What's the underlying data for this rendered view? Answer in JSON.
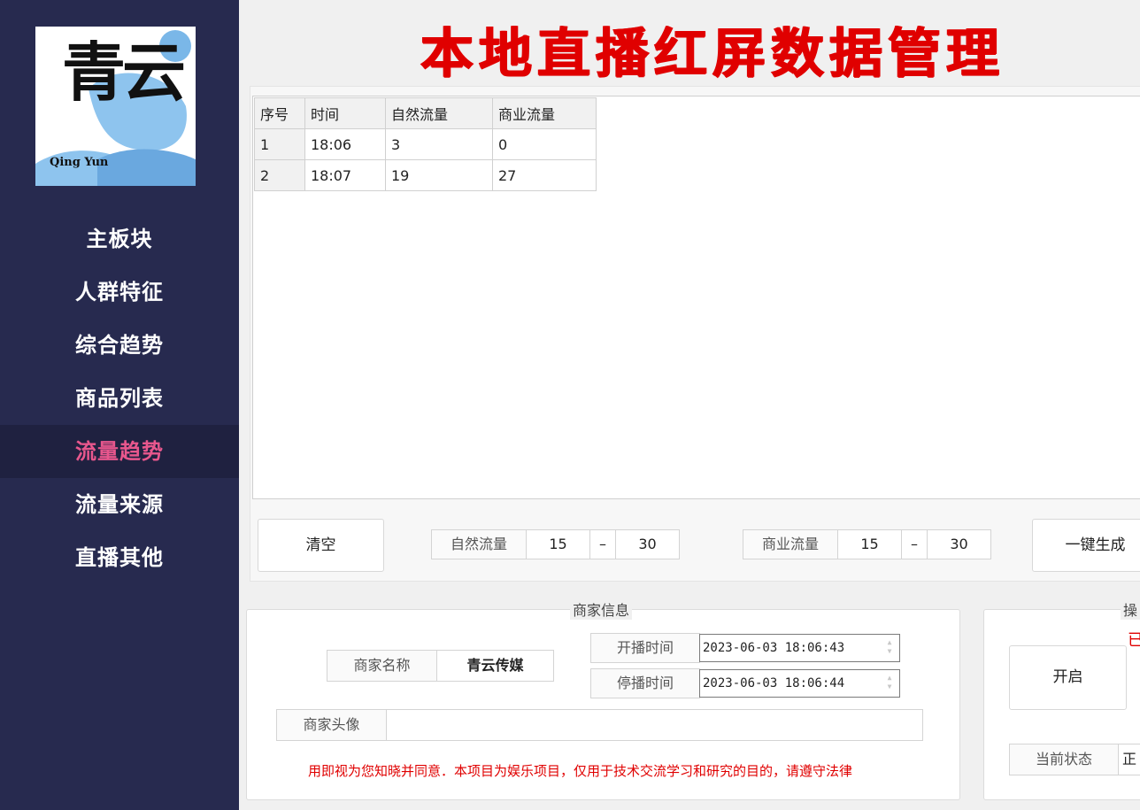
{
  "sidebar": {
    "logo": {
      "title": "青云",
      "subtitle": "Qing Yun"
    },
    "items": [
      {
        "label": "主板块"
      },
      {
        "label": "人群特征"
      },
      {
        "label": "综合趋势"
      },
      {
        "label": "商品列表"
      },
      {
        "label": "流量趋势",
        "active": true
      },
      {
        "label": "流量来源"
      },
      {
        "label": "直播其他"
      }
    ]
  },
  "header": {
    "title": "本地直播红屏数据管理"
  },
  "table": {
    "columns": [
      "序号",
      "时间",
      "自然流量",
      "商业流量"
    ],
    "rows": [
      [
        "1",
        "18:06",
        "3",
        "0"
      ],
      [
        "2",
        "18:07",
        "19",
        "27"
      ]
    ]
  },
  "controls": {
    "clear_label": "清空",
    "natural": {
      "label": "自然流量",
      "min": "15",
      "sep": "–",
      "max": "30"
    },
    "commercial": {
      "label": "商业流量",
      "min": "15",
      "sep": "–",
      "max": "30"
    },
    "generate_label": "一键生成"
  },
  "merchant": {
    "group_title": "商家信息",
    "name_label": "商家名称",
    "name_value": "青云传媒",
    "start_label": "开播时间",
    "start_value": "2023-06-03 18:06:43",
    "stop_label": "停播时间",
    "stop_value": "2023-06-03 18:06:44",
    "avatar_label": "商家头像",
    "avatar_value": "",
    "disclaimer": "用即视为您知晓并同意．本项目为娱乐项目，仅用于技术交流学习和研究的目的，请遵守法律"
  },
  "operation": {
    "group_title": "操",
    "status_text": "已",
    "start_label": "开启",
    "current_label": "当前状态",
    "current_value": "正"
  },
  "colors": {
    "sidebar_bg": "#272a4f",
    "active_item": "#e8578d",
    "title_red": "#e00000"
  }
}
